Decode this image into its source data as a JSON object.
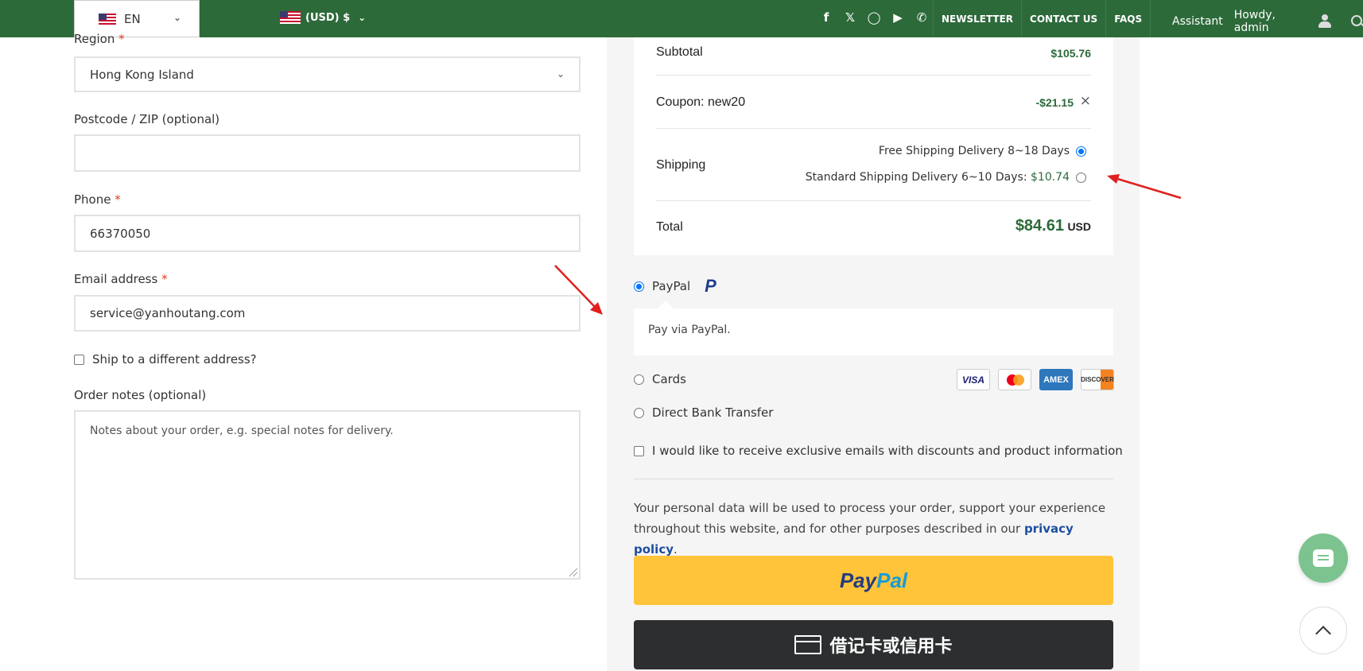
{
  "topbar": {
    "language": "EN",
    "currency": "(USD) $",
    "social_icons": [
      "facebook-icon",
      "x-icon",
      "instagram-icon",
      "youtube-icon",
      "whatsapp-icon"
    ],
    "nav_links": [
      "NEWSLETTER",
      "CONTACT US",
      "FAQS"
    ],
    "assistant": "Assistant",
    "greeting": "Howdy, admin",
    "bg_color": "#2d6a3a"
  },
  "form": {
    "region_label": "Region",
    "region_required": "*",
    "region_value": "Hong Kong Island",
    "postcode_label": "Postcode / ZIP (optional)",
    "postcode_value": "",
    "phone_label": "Phone",
    "phone_required": "*",
    "phone_value": "66370050",
    "email_label": "Email address",
    "email_required": "*",
    "email_value": "service@yanhoutang.com",
    "ship_different_label": "Ship to a different address?",
    "notes_label": "Order notes (optional)",
    "notes_placeholder": "Notes about your order, e.g. special notes for delivery."
  },
  "summary": {
    "subtotal_label": "Subtotal",
    "subtotal_value": "$105.76",
    "coupon_label": "Coupon: new20",
    "coupon_value": "-$21.15",
    "coupon_remove": "×",
    "shipping_label": "Shipping",
    "shipping_options": [
      {
        "label": "Free Shipping Delivery 8~18 Days",
        "price": "",
        "selected": true
      },
      {
        "label": "Standard Shipping Delivery 6~10 Days: ",
        "price": "$10.74",
        "selected": false
      }
    ],
    "total_label": "Total",
    "total_value": "$84.61",
    "total_currency": "USD"
  },
  "payment": {
    "paypal_label": "PayPal",
    "paypal_desc": "Pay via PayPal.",
    "cards_label": "Cards",
    "card_brands": [
      "VISA",
      "mastercard",
      "AMEX",
      "DISCOVER"
    ],
    "bank_label": "Direct Bank Transfer",
    "newsletter_opt": "I would like to receive exclusive emails with discounts and product information",
    "privacy_text": "Your personal data will be used to process your order, support your experience throughout this website, and for other purposes described in our ",
    "privacy_link": "privacy policy",
    "privacy_end": ".",
    "paypal_button_pay": "Pay",
    "paypal_button_pal": "Pal",
    "card_button": "借记卡或信用卡"
  }
}
